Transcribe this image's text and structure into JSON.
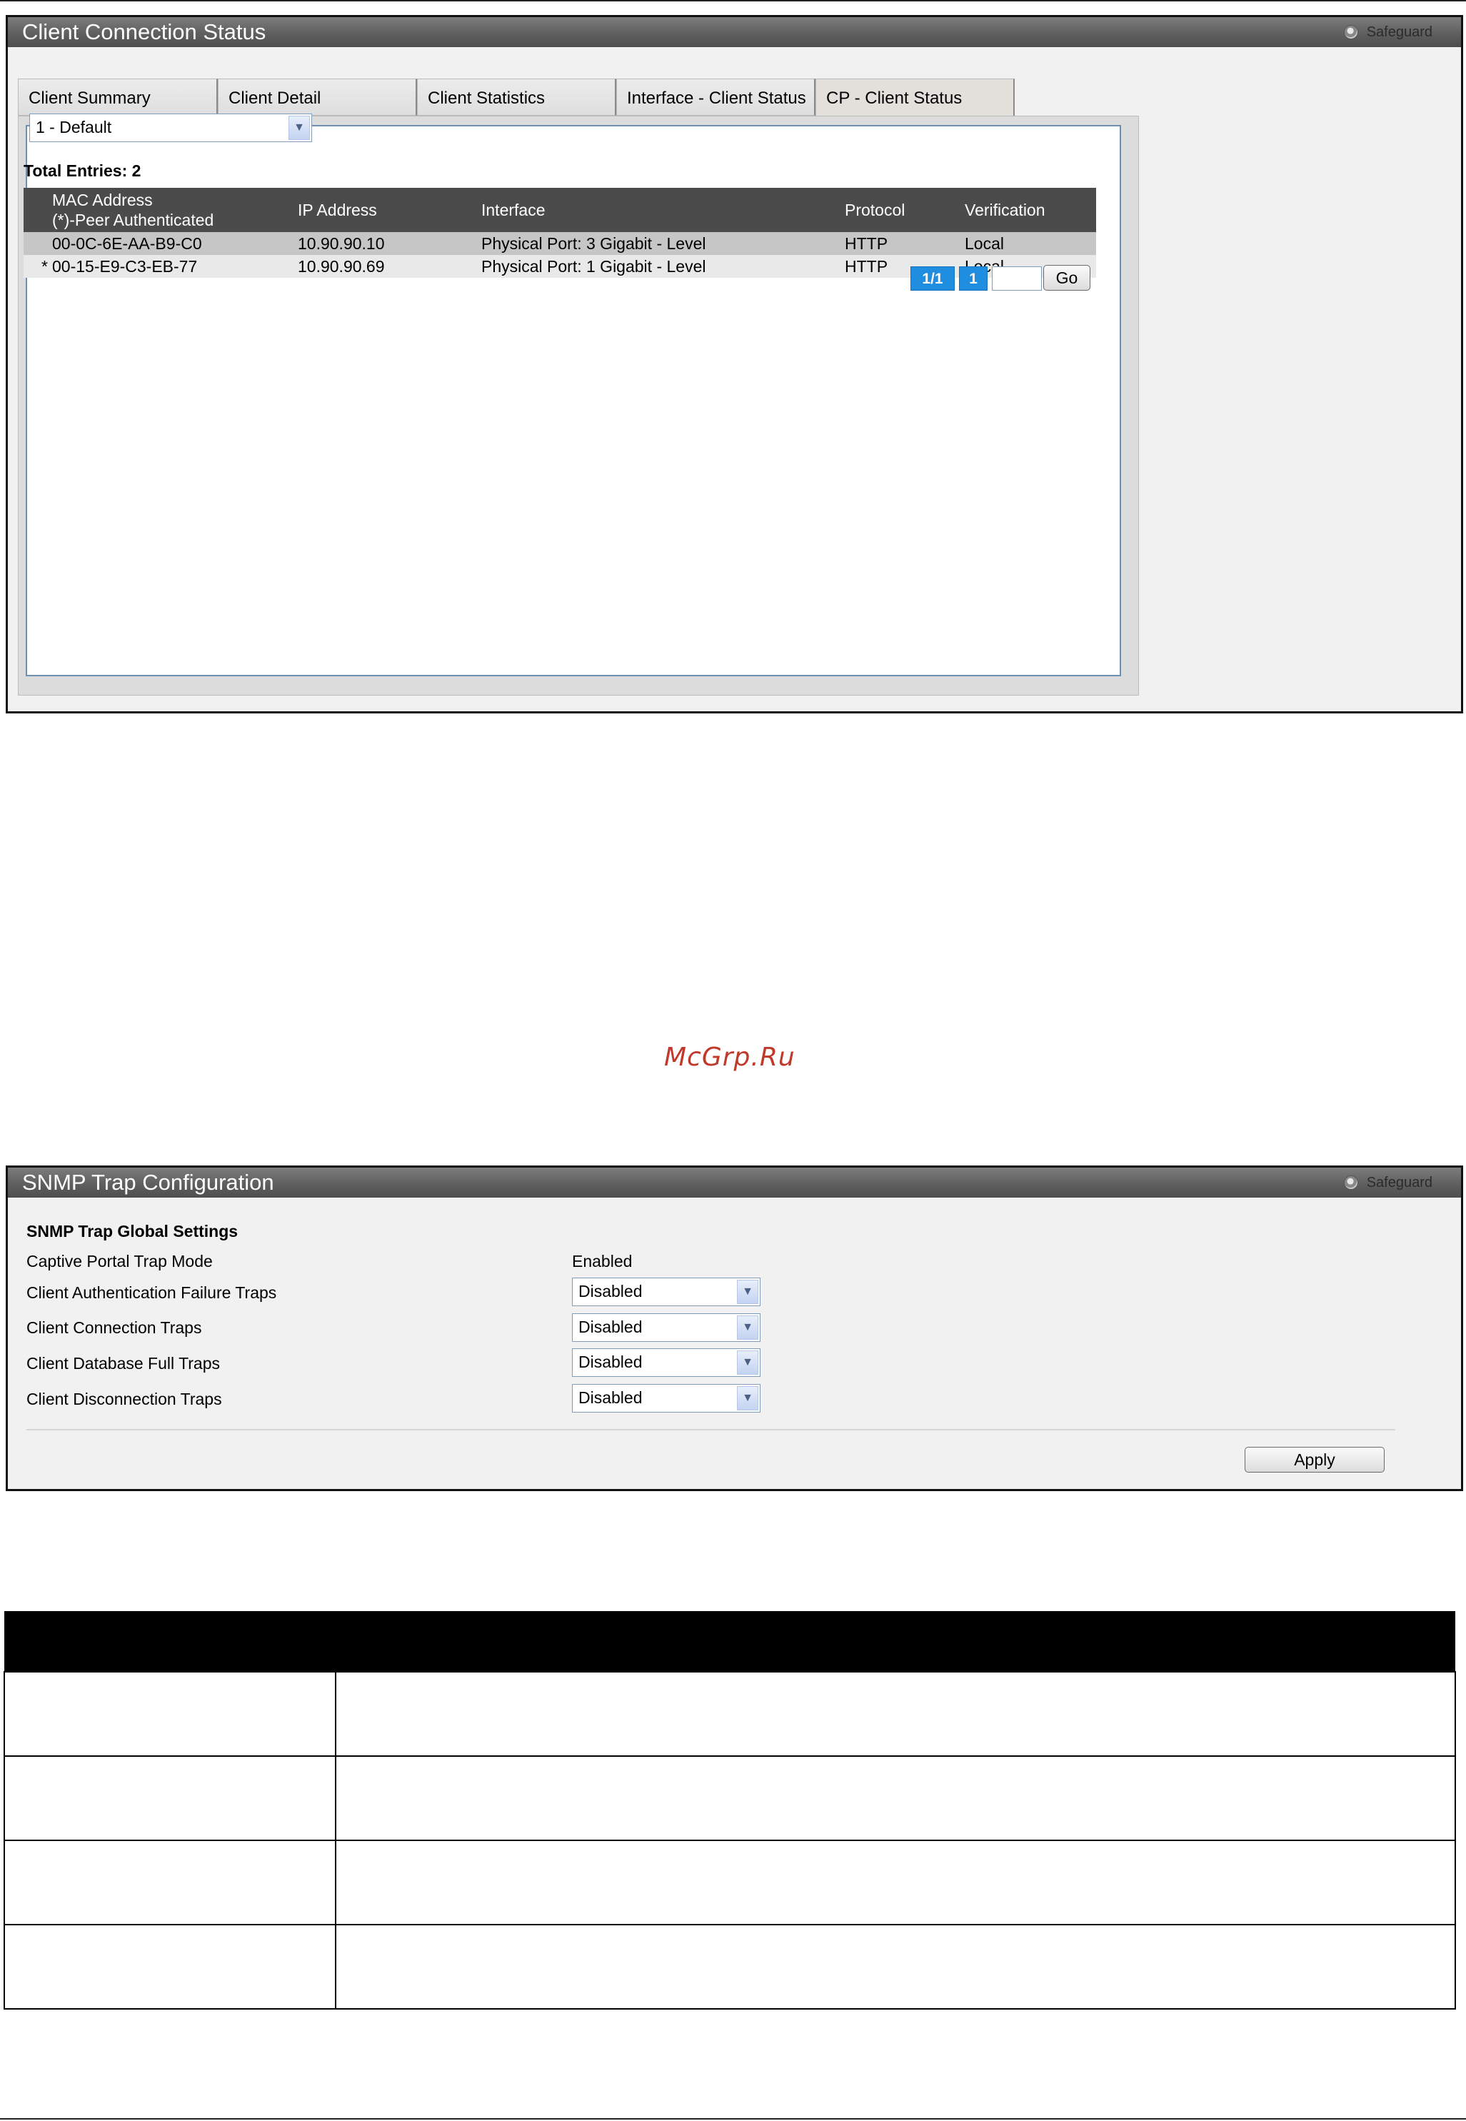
{
  "client_connection_status": {
    "title": "Client Connection Status",
    "safeguard": "Safeguard",
    "tabs": [
      {
        "label": "Client Summary"
      },
      {
        "label": "Client Detail"
      },
      {
        "label": "Client Statistics"
      },
      {
        "label": "Interface - Client Status"
      },
      {
        "label": "CP - Client Status",
        "active": true
      }
    ],
    "config_select": "1 - Default",
    "total_entries": "Total Entries: 2",
    "table": {
      "headers": {
        "mac_line1": "MAC Address",
        "mac_line2": "(*)-Peer Authenticated",
        "ip": "IP Address",
        "interface": "Interface",
        "protocol": "Protocol",
        "verification": "Verification"
      },
      "rows": [
        {
          "marker": "",
          "mac": "00-0C-6E-AA-B9-C0",
          "ip": "10.90.90.10",
          "interface": "Physical Port: 3 Gigabit - Level",
          "protocol": "HTTP",
          "verification": "Local"
        },
        {
          "marker": "*",
          "mac": "00-15-E9-C3-EB-77",
          "ip": "10.90.90.69",
          "interface": "Physical Port: 1 Gigabit - Level",
          "protocol": "HTTP",
          "verification": "Local"
        }
      ]
    },
    "pager": {
      "page_of": "1/1",
      "page": "1",
      "go_label": "Go"
    }
  },
  "watermark": "McGrp.Ru",
  "snmp_trap_configuration": {
    "title": "SNMP Trap Configuration",
    "safeguard": "Safeguard",
    "section_title": "SNMP Trap Global Settings",
    "fields": [
      {
        "label": "Captive Portal Trap Mode",
        "value": "Enabled"
      },
      {
        "label": "Client Authentication Failure Traps",
        "value": "Disabled"
      },
      {
        "label": "Client Connection Traps",
        "value": "Disabled"
      },
      {
        "label": "Client Database Full Traps",
        "value": "Disabled"
      },
      {
        "label": "Client Disconnection Traps",
        "value": "Disabled"
      }
    ],
    "apply_label": "Apply"
  }
}
